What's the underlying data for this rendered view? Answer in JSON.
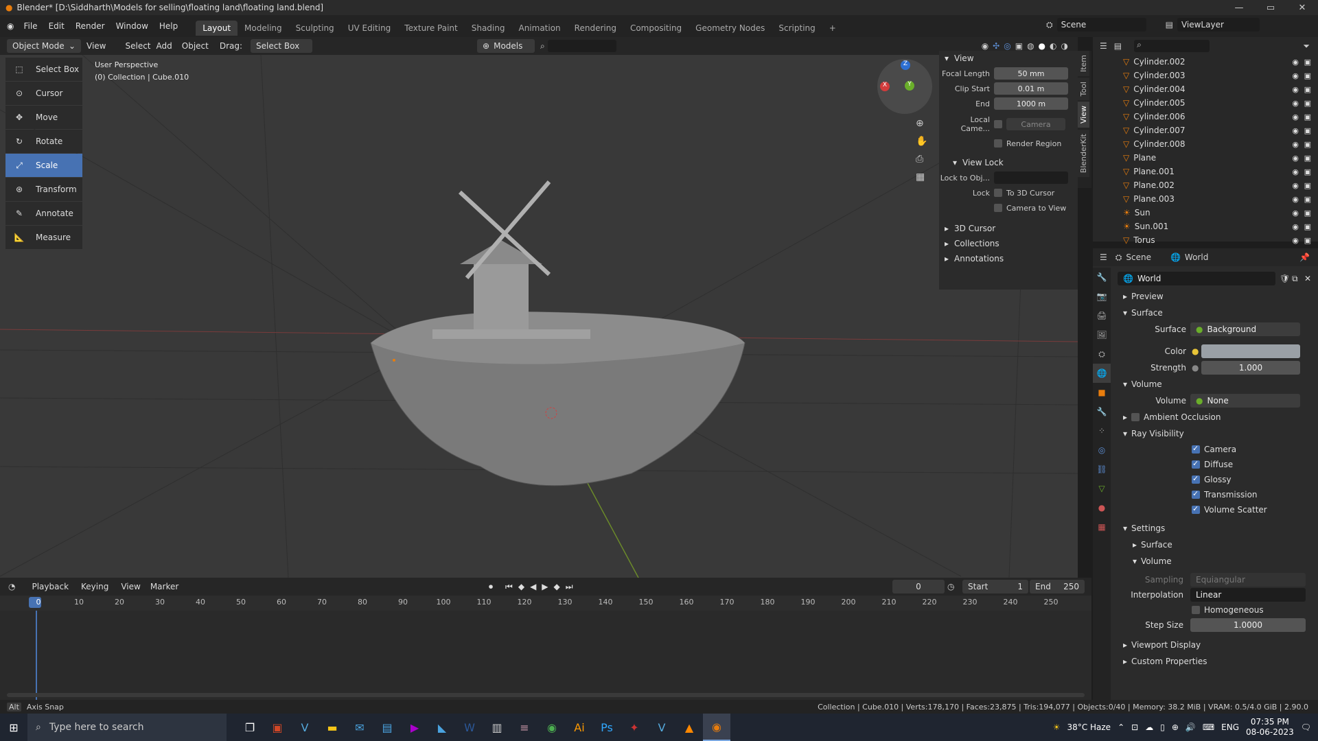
{
  "window": {
    "title": "Blender* [D:\\Siddharth\\Models for selling\\floating land\\floating land.blend]",
    "min": "—",
    "max": "▭",
    "close": "✕"
  },
  "menu": [
    "File",
    "Edit",
    "Render",
    "Window",
    "Help"
  ],
  "workspaces": [
    "Layout",
    "Modeling",
    "Sculpting",
    "UV Editing",
    "Texture Paint",
    "Shading",
    "Animation",
    "Rendering",
    "Compositing",
    "Geometry Nodes",
    "Scripting",
    "+"
  ],
  "scene": {
    "name": "Scene",
    "viewlayer": "ViewLayer"
  },
  "header3d": {
    "mode": "Object Mode",
    "view": "View",
    "select": "Select",
    "add": "Add",
    "object": "Object",
    "drag": "Drag:",
    "drag_mode": "Select Box",
    "orientation": "Models"
  },
  "viewport": {
    "line1": "User Perspective",
    "line2": "(0) Collection | Cube.010"
  },
  "tools": [
    "Select Box",
    "Cursor",
    "Move",
    "Rotate",
    "Scale",
    "Transform",
    "Annotate",
    "Measure"
  ],
  "npanel": {
    "view_header": "View",
    "focal_label": "Focal Length",
    "focal": "50 mm",
    "clipstart_label": "Clip Start",
    "clipstart": "0.01 m",
    "end_label": "End",
    "end": "1000 m",
    "localcam_label": "Local Came...",
    "localcam": "Camera",
    "render_region": "Render Region",
    "viewlock_header": "View Lock",
    "lockobj_label": "Lock to Obj...",
    "lock_label": "Lock",
    "to3d": "To 3D Cursor",
    "camtoview": "Camera to View",
    "cursor3d": "3D Cursor",
    "collections": "Collections",
    "annotations": "Annotations",
    "tabs": [
      "Item",
      "Tool",
      "View",
      "BlenderKit"
    ]
  },
  "outliner": [
    "Cylinder.002",
    "Cylinder.003",
    "Cylinder.004",
    "Cylinder.005",
    "Cylinder.006",
    "Cylinder.007",
    "Cylinder.008",
    "Plane",
    "Plane.001",
    "Plane.002",
    "Plane.003",
    "Sun",
    "Sun.001",
    "Torus"
  ],
  "props": {
    "tab_scene": "Scene",
    "tab_world": "World",
    "world_name": "World",
    "preview": "Preview",
    "surface_header": "Surface",
    "surface_label": "Surface",
    "surface": "Background",
    "color_label": "Color",
    "strength_label": "Strength",
    "strength": "1.000",
    "volume_header": "Volume",
    "volume_label": "Volume",
    "volume": "None",
    "ao": "Ambient Occlusion",
    "rayvis": "Ray Visibility",
    "rv_items": [
      "Camera",
      "Diffuse",
      "Glossy",
      "Transmission",
      "Volume Scatter"
    ],
    "settings": "Settings",
    "set_surface": "Surface",
    "set_volume": "Volume",
    "sampling_label": "Sampling",
    "sampling": "Equiangular",
    "interp_label": "Interpolation",
    "interp": "Linear",
    "homogeneous": "Homogeneous",
    "stepsize_label": "Step Size",
    "stepsize": "1.0000",
    "viewport_display": "Viewport Display",
    "custom_props": "Custom Properties",
    "world_color": "#9aa0a6"
  },
  "timeline": {
    "playback": "Playback",
    "keying": "Keying",
    "view": "View",
    "marker": "Marker",
    "current": "0",
    "start_label": "Start",
    "start": "1",
    "end_label": "End",
    "end": "250",
    "ticks": [
      "0",
      "10",
      "20",
      "30",
      "40",
      "50",
      "60",
      "70",
      "80",
      "90",
      "100",
      "110",
      "120",
      "130",
      "140",
      "150",
      "160",
      "170",
      "180",
      "190",
      "200",
      "210",
      "220",
      "230",
      "240",
      "250"
    ]
  },
  "status": {
    "left": "Axis Snap",
    "right": "Collection | Cube.010 | Verts:178,170 | Faces:23,875 | Tris:194,077 | Objects:0/40 | Memory: 38.2 MiB | VRAM: 0.5/4.0 GiB | 2.90.0"
  },
  "taskbar": {
    "search": "Type here to search",
    "weather": "38°C  Haze",
    "lang": "ENG",
    "time": "07:35 PM",
    "date": "08-06-2023"
  }
}
